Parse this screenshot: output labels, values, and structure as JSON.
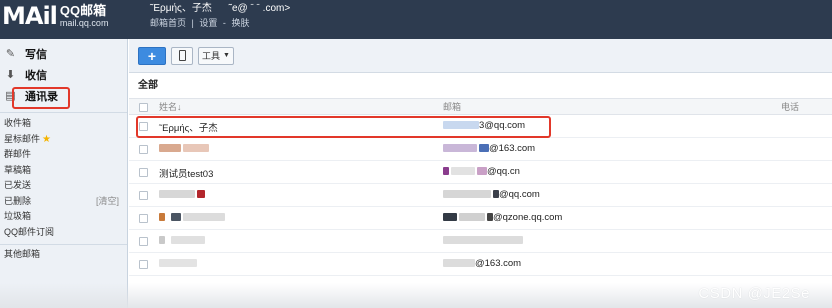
{
  "header": {
    "logo_mark": "MAil",
    "logo_cn": "QQ邮箱",
    "logo_domain": "mail.qq.com",
    "user_display": "˜Ερμής、子杰",
    "user_email_tail": "˜e@ ˉ ˉ .com>",
    "nav_home": "邮箱首页",
    "nav_sep1": "|",
    "nav_settings": "设置",
    "nav_sep2": "-",
    "nav_skin": "换肤"
  },
  "sidebar": {
    "compose": "写信",
    "inbox": "收信",
    "contacts": "通讯录",
    "folders": [
      {
        "label": "收件箱"
      },
      {
        "label": "星标邮件"
      },
      {
        "label": "群邮件"
      },
      {
        "label": "草稿箱"
      },
      {
        "label": "已发送"
      },
      {
        "label": "已删除"
      },
      {
        "label": "垃圾箱"
      },
      {
        "label": "QQ邮件订阅"
      }
    ],
    "clear_label": "[清空]",
    "other_mailboxes": "其他邮箱"
  },
  "toolbar": {
    "add_label": "+",
    "tools_label": "工具"
  },
  "main": {
    "section_title": "全部",
    "col_name": "姓名↓",
    "col_email": "邮箱",
    "col_phone": "电话"
  },
  "contacts": [
    {
      "name": "˜Ερμής、子杰",
      "email_suffix": "3@qq.com"
    },
    {
      "name": "",
      "email_suffix": "@163.com"
    },
    {
      "name": "测试员test03",
      "email_suffix": "@qq.cn"
    },
    {
      "name": "",
      "email_suffix": "@qq.com"
    },
    {
      "name": "",
      "email_suffix": "@qzone.qq.com"
    },
    {
      "name": "",
      "email_suffix": ""
    },
    {
      "name": "",
      "email_suffix": "@163.com"
    }
  ],
  "watermark": "CSDN @JE2Se",
  "colors": {
    "header_bg": "#2d3b4f",
    "sidebar_bg": "#edf1f6",
    "highlight_red": "#e2382a",
    "add_button_blue": "#3d8be0"
  }
}
